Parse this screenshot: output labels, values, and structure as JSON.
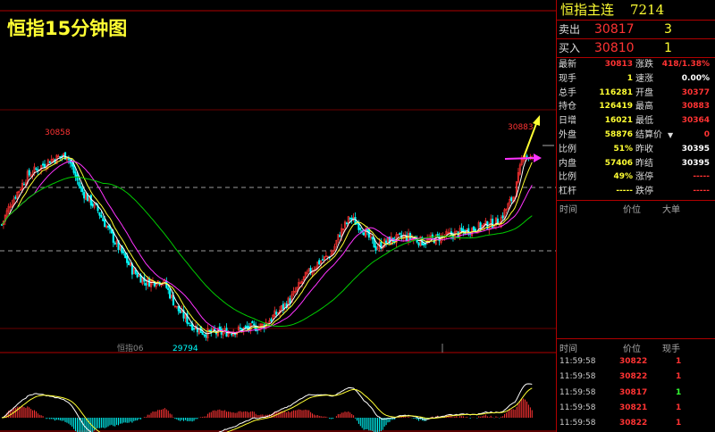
{
  "chart": {
    "title": "恒指15分钟图",
    "high_label": "30858",
    "high_label_right": "30883",
    "low_label": "29794",
    "contract_label": "恒指06"
  },
  "quote": {
    "name": "恒指主连",
    "code": "7214",
    "sell_label": "卖出",
    "sell_price": "30817",
    "sell_qty": "3",
    "buy_label": "买入",
    "buy_price": "30810",
    "buy_qty": "1"
  },
  "stats": [
    {
      "k": "最新",
      "v": "30813",
      "c": "r"
    },
    {
      "k": "涨跌",
      "v": "418/1.38%",
      "c": "r"
    },
    {
      "k": "现手",
      "v": "1",
      "c": "y"
    },
    {
      "k": "速涨",
      "v": "0.00%",
      "c": "w"
    },
    {
      "k": "总手",
      "v": "116281",
      "c": "y"
    },
    {
      "k": "开盘",
      "v": "30377",
      "c": "r"
    },
    {
      "k": "持仓",
      "v": "126419",
      "c": "y"
    },
    {
      "k": "最高",
      "v": "30883",
      "c": "r"
    },
    {
      "k": "日增",
      "v": "16021",
      "c": "y"
    },
    {
      "k": "最低",
      "v": "30364",
      "c": "r"
    },
    {
      "k": "外盘",
      "v": "58876",
      "c": "y"
    },
    {
      "k": "结算价",
      "v": "0",
      "c": "r"
    },
    {
      "k": "比例",
      "v": "51%",
      "c": "y"
    },
    {
      "k": "昨收",
      "v": "30395",
      "c": "w"
    },
    {
      "k": "内盘",
      "v": "57406",
      "c": "y"
    },
    {
      "k": "昨结",
      "v": "30395",
      "c": "w"
    },
    {
      "k": "比例",
      "v": "49%",
      "c": "y"
    },
    {
      "k": "涨停",
      "v": "-----",
      "c": "r"
    },
    {
      "k": "杠杆",
      "v": "-----",
      "c": "y"
    },
    {
      "k": "跌停",
      "v": "-----",
      "c": "r"
    }
  ],
  "upper_table": {
    "h_time": "时间",
    "h_price": "价位",
    "h_big": "大单"
  },
  "lower_table": {
    "h_time": "时间",
    "h_price": "价位",
    "h_qty": "现手"
  },
  "ticks": [
    {
      "time": "11:59:58",
      "price": "30822",
      "qty": "1",
      "color": "r"
    },
    {
      "time": "11:59:58",
      "price": "30822",
      "qty": "1",
      "color": "r"
    },
    {
      "time": "11:59:58",
      "price": "30817",
      "qty": "1",
      "color": "g"
    },
    {
      "time": "11:59:58",
      "price": "30821",
      "qty": "1",
      "color": "r"
    },
    {
      "time": "11:59:58",
      "price": "30822",
      "qty": "1",
      "color": "r"
    }
  ],
  "colors": {
    "up": "#ff3333",
    "down": "#00ffff",
    "ma5": "#ffffff",
    "ma10": "#ffff33",
    "ma20": "#ff33ff",
    "ma60": "#00cc00",
    "border": "#b00000",
    "arrow_up": "#ffff33",
    "arrow_mid": "#ff33ff"
  },
  "chart_data": {
    "type": "candlestick",
    "price_range": [
      29794,
      30883
    ],
    "anchors": [
      [
        0,
        30440
      ],
      [
        5,
        30560
      ],
      [
        15,
        30720
      ],
      [
        28,
        30810
      ],
      [
        38,
        30840
      ],
      [
        46,
        30640
      ],
      [
        56,
        30520
      ],
      [
        66,
        30340
      ],
      [
        76,
        30180
      ],
      [
        84,
        30110
      ],
      [
        94,
        30120
      ],
      [
        102,
        29960
      ],
      [
        110,
        29870
      ],
      [
        118,
        29820
      ],
      [
        128,
        29820
      ],
      [
        140,
        29840
      ],
      [
        152,
        29860
      ],
      [
        160,
        29930
      ],
      [
        168,
        30010
      ],
      [
        176,
        30130
      ],
      [
        184,
        30220
      ],
      [
        192,
        30270
      ],
      [
        197,
        30390
      ],
      [
        203,
        30480
      ],
      [
        210,
        30420
      ],
      [
        218,
        30310
      ],
      [
        226,
        30350
      ],
      [
        236,
        30370
      ],
      [
        246,
        30340
      ],
      [
        256,
        30370
      ],
      [
        266,
        30390
      ],
      [
        276,
        30420
      ],
      [
        290,
        30460
      ],
      [
        299,
        30620
      ],
      [
        304,
        30850
      ],
      [
        309,
        30810
      ]
    ]
  }
}
